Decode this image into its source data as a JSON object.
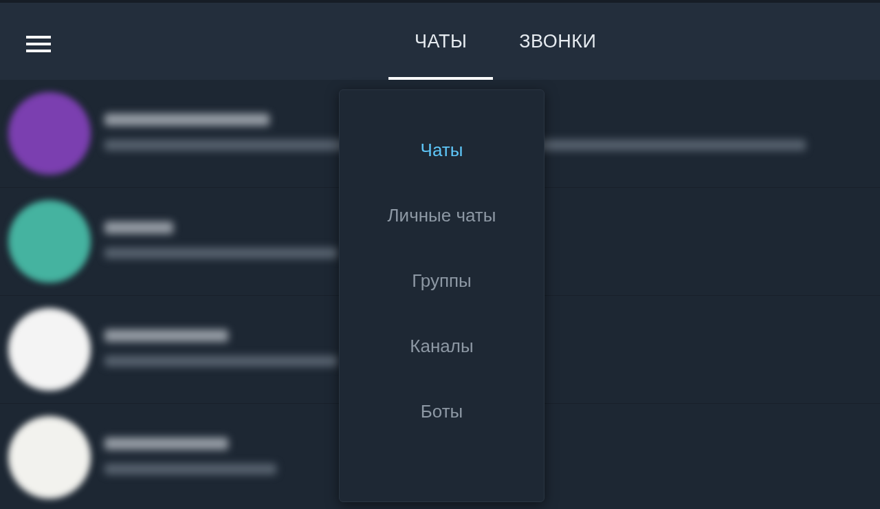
{
  "tabs": [
    {
      "label": "ЧАТЫ",
      "selected": true
    },
    {
      "label": "ЗВОНКИ",
      "selected": false
    }
  ],
  "filter_menu": {
    "items": [
      {
        "label": "Чаты",
        "selected": true
      },
      {
        "label": "Личные чаты",
        "selected": false
      },
      {
        "label": "Группы",
        "selected": false
      },
      {
        "label": "Каналы",
        "selected": false
      },
      {
        "label": "Боты",
        "selected": false
      }
    ]
  },
  "chats": [
    {
      "color": "#7b3fb0"
    },
    {
      "color": "#45b3a0"
    },
    {
      "color": "#f4f4f4"
    },
    {
      "color": "#f2f2ee"
    }
  ]
}
